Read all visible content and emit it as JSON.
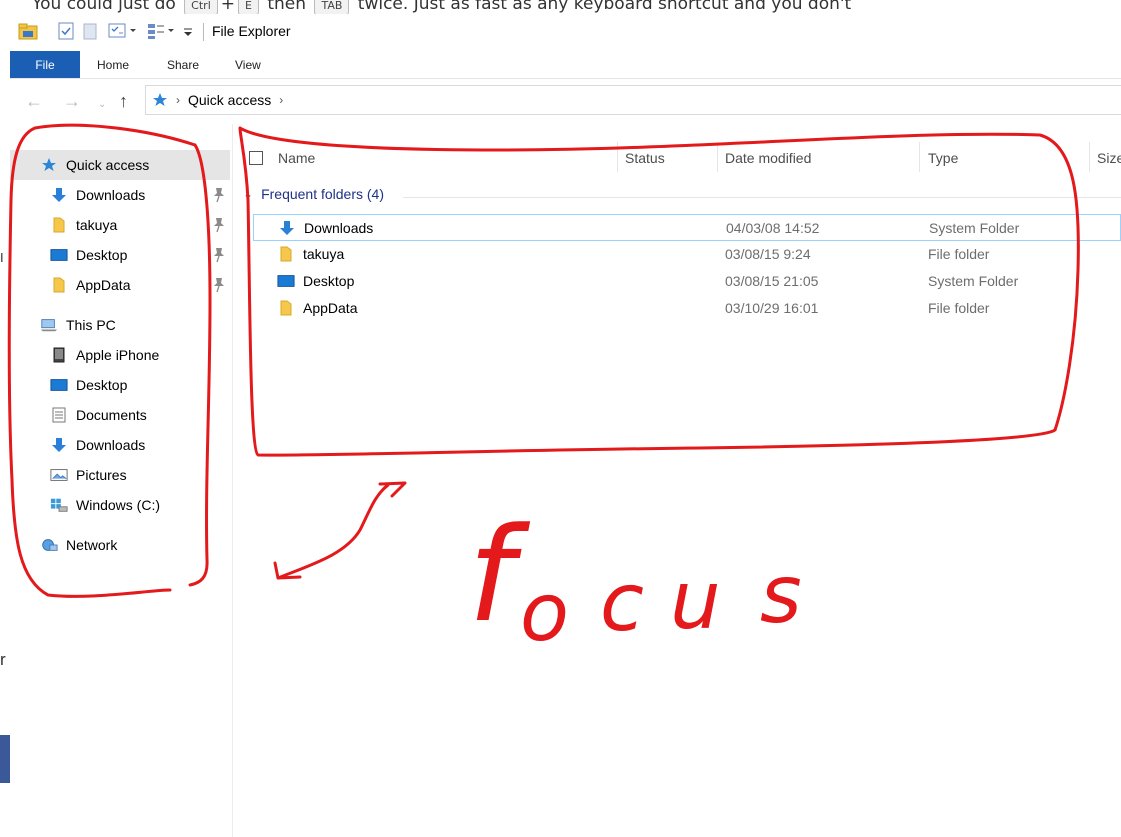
{
  "background": {
    "text_before": "You could just do",
    "key_ctrl": "Ctrl",
    "plus": "+",
    "key_e": "E",
    "text_then": "then",
    "key_tab": "TAB",
    "text_after": "twice. Just as fast as any keyboard shortcut and you don't",
    "left_fragment_1": "I",
    "left_fragment_2": "r"
  },
  "window": {
    "title": "File Explorer"
  },
  "ribbon": {
    "tabs": [
      {
        "label": "File"
      },
      {
        "label": "Home"
      },
      {
        "label": "Share"
      },
      {
        "label": "View"
      }
    ]
  },
  "address": {
    "location": "Quick access"
  },
  "nav": {
    "quick_access": "Quick access",
    "pinned": [
      "Downloads",
      "takuya",
      "Desktop",
      "AppData"
    ],
    "this_pc": "This PC",
    "pc_items": [
      "Apple iPhone",
      "Desktop",
      "Documents",
      "Downloads",
      "Pictures",
      "Windows (C:)"
    ],
    "network": "Network"
  },
  "columns": {
    "name": "Name",
    "status": "Status",
    "date": "Date modified",
    "type": "Type",
    "size": "Size"
  },
  "group": {
    "label": "Frequent folders (4)"
  },
  "rows": [
    {
      "name": "Downloads",
      "date": "04/03/08 14:52",
      "type": "System Folder",
      "icon": "download-arrow-icon"
    },
    {
      "name": "takuya",
      "date": "03/08/15 9:24",
      "type": "File folder",
      "icon": "folder-icon"
    },
    {
      "name": "Desktop",
      "date": "03/08/15 21:05",
      "type": "System Folder",
      "icon": "desktop-icon"
    },
    {
      "name": "AppData",
      "date": "03/10/29 16:01",
      "type": "File folder",
      "icon": "folder-icon"
    }
  ],
  "annotation": {
    "text": "focus",
    "color": "#e3191b"
  },
  "colors": {
    "accent": "#1a5fb4",
    "selection": "#e5e5e5",
    "annotation": "#e3191b"
  }
}
